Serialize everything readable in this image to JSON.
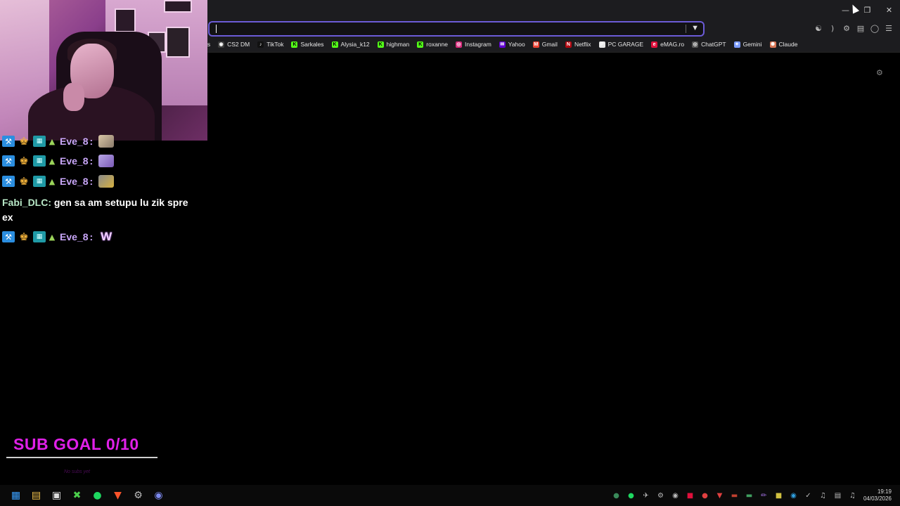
{
  "browser": {
    "url_value": "",
    "bookmarks": [
      {
        "label": "rs",
        "icon": "cut-off-icon",
        "color": "#1c1c1f"
      },
      {
        "label": "CS2 DM",
        "icon": "cs2-icon",
        "color": "#3a3a3a"
      },
      {
        "label": "TikTok",
        "icon": "tiktok-icon",
        "color": "#111111"
      },
      {
        "label": "Sarkales",
        "icon": "kick-icon",
        "color": "#53fc18"
      },
      {
        "label": "Alysia_k12",
        "icon": "kick-icon",
        "color": "#53fc18"
      },
      {
        "label": "highman",
        "icon": "kick-icon",
        "color": "#53fc18"
      },
      {
        "label": "roxanne",
        "icon": "kick-icon",
        "color": "#53fc18"
      },
      {
        "label": "Instagram",
        "icon": "instagram-icon",
        "color": "#d6297a"
      },
      {
        "label": "Yahoo",
        "icon": "yahoo-icon",
        "color": "#6001d2"
      },
      {
        "label": "Gmail",
        "icon": "gmail-icon",
        "color": "#ea4335"
      },
      {
        "label": "Netflix",
        "icon": "netflix-icon",
        "color": "#b20710"
      },
      {
        "label": "PC GARAGE",
        "icon": "pcgarage-icon",
        "color": "#e8e8e8"
      },
      {
        "label": "eMAG.ro",
        "icon": "emag-icon",
        "color": "#e0103c"
      },
      {
        "label": "ChatGPT",
        "icon": "chatgpt-icon",
        "color": "#555555"
      },
      {
        "label": "Gemini",
        "icon": "gemini-icon",
        "color": "#7c9cff"
      },
      {
        "label": "Claude",
        "icon": "claude-icon",
        "color": "#d97757"
      }
    ]
  },
  "chat": {
    "messages": [
      {
        "user": "Eve_8",
        "text": ""
      },
      {
        "user": "Eve_8",
        "text": ""
      },
      {
        "user": "Eve_8",
        "text": ""
      },
      {
        "user": "Fabi_DLC",
        "text": "gen sa am setupu lu zik spre ex"
      },
      {
        "user": "Eve_8",
        "text": "W"
      }
    ],
    "colors": {
      "eve": "#c8a6f7",
      "fabi": "#b7e7c6"
    }
  },
  "overlay": {
    "sub_goal": "SUB GOAL 0/10",
    "sub_goal_sub": "No subs yet",
    "accent": "#e020e8"
  },
  "taskbar": {
    "time": "19:19",
    "date": "04/03/2026"
  }
}
